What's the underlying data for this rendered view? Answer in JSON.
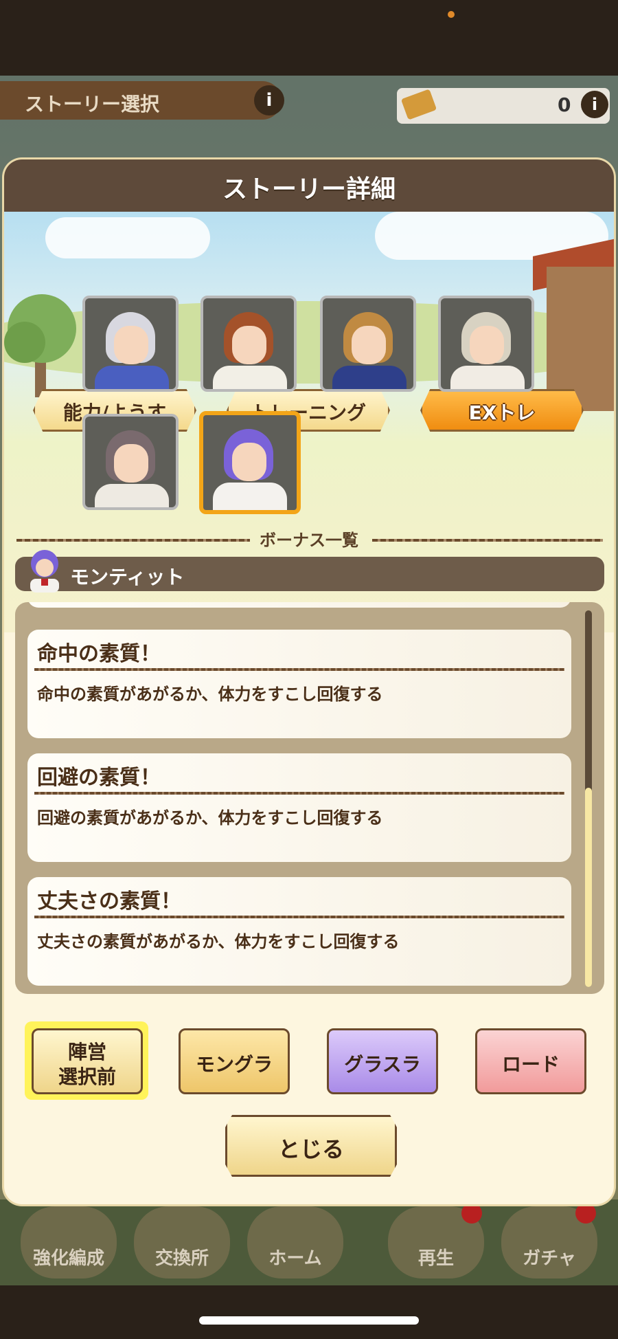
{
  "background": {
    "story_select_label": "ストーリー選択",
    "info_icon": "i",
    "currency_value": "0",
    "nav_items": [
      "強化編成",
      "交換所",
      "ホーム",
      "再生",
      "ガチャ"
    ]
  },
  "modal": {
    "title": "ストーリー詳細",
    "tabs": [
      "能力/ようす",
      "トレーニング",
      "EXトレ"
    ],
    "active_tab": "EXトレ",
    "section_label": "ボーナス一覧",
    "selected_character": "モンティット",
    "bonuses": [
      {
        "title": "命中の素質！",
        "desc": "命中の素質があがるか、体力をすこし回復する"
      },
      {
        "title": "回避の素質！",
        "desc": "回避の素質があがるか、体力をすこし回復する"
      },
      {
        "title": "丈夫さの素質！",
        "desc": "丈夫さの素質があがるか、体力をすこし回復する"
      }
    ],
    "mode_buttons": [
      {
        "line1": "陣営",
        "line2": "選択前"
      },
      {
        "label": "モングラ"
      },
      {
        "label": "グラスラ"
      },
      {
        "label": "ロード"
      }
    ],
    "close_label": "とじる"
  },
  "colors": {
    "accent_orange": "#f08d11",
    "header_brown": "#5e4a3a",
    "text_brown": "#4a2f18",
    "highlight_yellow": "#fff35a"
  }
}
